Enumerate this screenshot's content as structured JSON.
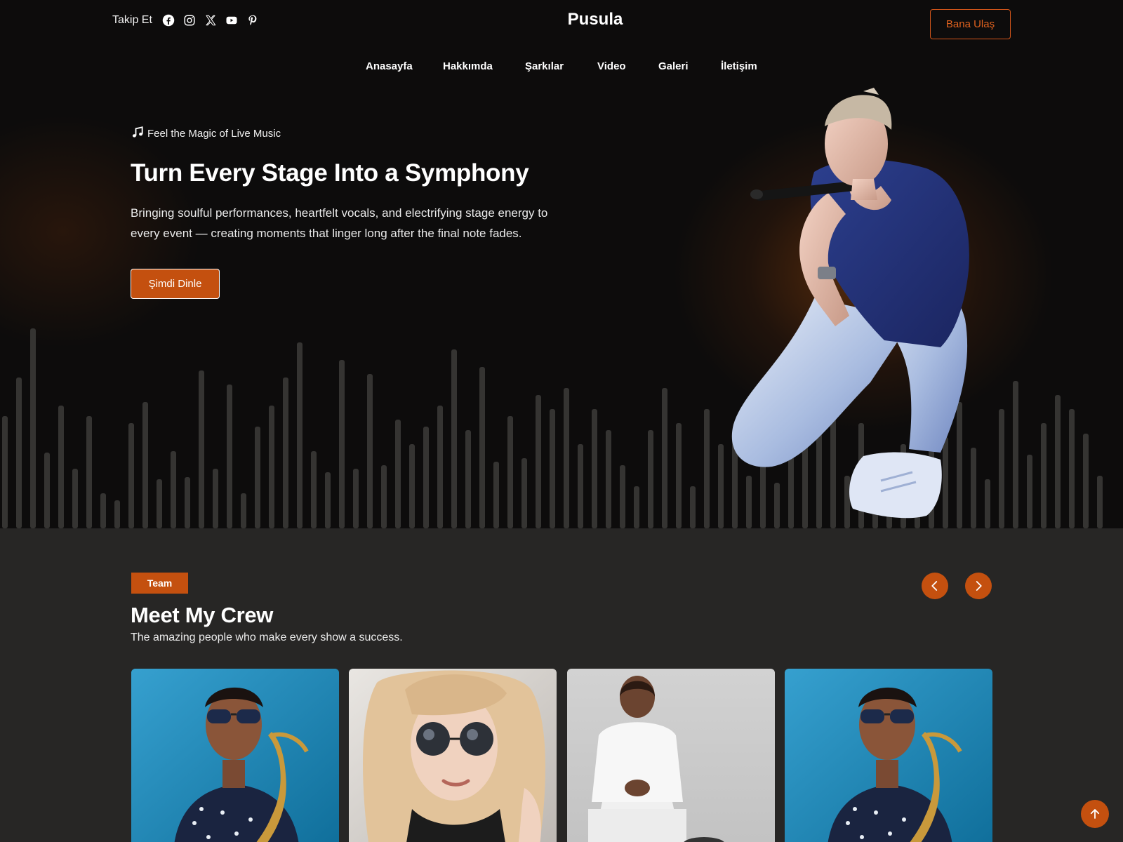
{
  "header": {
    "follow_label": "Takip Et",
    "social_icons": [
      "facebook-icon",
      "instagram-icon",
      "x-icon",
      "youtube-icon",
      "pinterest-icon"
    ],
    "brand": "Pusula",
    "contact_button": "Bana Ulaş"
  },
  "nav": {
    "items": [
      "Anasayfa",
      "Hakkımda",
      "Şarkılar",
      "Video",
      "Galeri",
      "İletişim"
    ]
  },
  "hero": {
    "tagline": "Feel the Magic of Live Music",
    "title": "Turn Every Stage Into a Symphony",
    "description": "Bringing soulful performances, heartfelt vocals, and electrifying stage energy to every event — creating moments that linger long after the final note fades.",
    "button": "Şimdi Dinle"
  },
  "team": {
    "badge": "Team",
    "title": "Meet My Crew",
    "subtitle": "The amazing people who make every show a success."
  },
  "colors": {
    "accent": "#c4500f",
    "hero_bg": "#0d0c0c",
    "section_bg": "#272625"
  }
}
